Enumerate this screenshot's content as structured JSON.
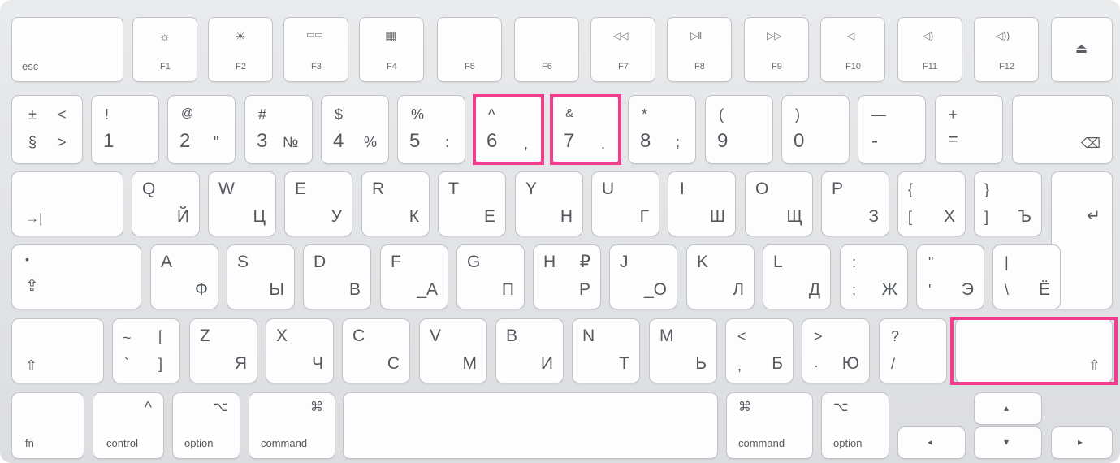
{
  "fn_row": {
    "esc": "esc",
    "f1": {
      "label": "F1",
      "icon": "☼"
    },
    "f2": {
      "label": "F2",
      "icon": "☀"
    },
    "f3": {
      "label": "F3",
      "icon": "▭▭"
    },
    "f4": {
      "label": "F4",
      "icon": "▦"
    },
    "f5": {
      "label": "F5"
    },
    "f6": {
      "label": "F6"
    },
    "f7": {
      "label": "F7",
      "icon": "◁◁"
    },
    "f8": {
      "label": "F8",
      "icon": "▷ǁ"
    },
    "f9": {
      "label": "F9",
      "icon": "▷▷"
    },
    "f10": {
      "label": "F10",
      "icon": "◁"
    },
    "f11": {
      "label": "F11",
      "icon": "◁)"
    },
    "f12": {
      "label": "F12",
      "icon": "◁))"
    },
    "eject_icon": "⏏"
  },
  "num_row": {
    "k0": {
      "tl": "±",
      "tr": "<",
      "bl": "§",
      "br": ">"
    },
    "k1": {
      "tl": "!",
      "bl": "1"
    },
    "k2": {
      "tl": "@",
      "bl": "2",
      "br": "\""
    },
    "k3": {
      "tl": "#",
      "bl": "3",
      "br": "№"
    },
    "k4": {
      "tl": "$",
      "bl": "4",
      "br": "%"
    },
    "k5": {
      "tl": "%",
      "bl": "5",
      "br": ":"
    },
    "k6": {
      "tl": "^",
      "bl": "6",
      "br": ","
    },
    "k7": {
      "tl": "&",
      "bl": "7",
      "br": "."
    },
    "k8": {
      "tl": "*",
      "bl": "8",
      "br": ";"
    },
    "k9": {
      "tl": "(",
      "bl": "9"
    },
    "k10": {
      "tl": ")",
      "bl": "0"
    },
    "k11": {
      "tl": "—",
      "bl": "-"
    },
    "k12": {
      "tl": "+",
      "bl": "="
    },
    "delete_icon": "⌫"
  },
  "q_row": {
    "tab_icon": "→|",
    "keys": [
      {
        "en": "Q",
        "ru": "Й"
      },
      {
        "en": "W",
        "ru": "Ц"
      },
      {
        "en": "E",
        "ru": "У"
      },
      {
        "en": "R",
        "ru": "К"
      },
      {
        "en": "T",
        "ru": "Е"
      },
      {
        "en": "Y",
        "ru": "Н"
      },
      {
        "en": "U",
        "ru": "Г"
      },
      {
        "en": "I",
        "ru": "Ш"
      },
      {
        "en": "O",
        "ru": "Щ"
      },
      {
        "en": "P",
        "ru": "З"
      }
    ],
    "bracket_left": {
      "tl": "{",
      "bl": "[",
      "br": "Х"
    },
    "bracket_right": {
      "tl": "}",
      "bl": "]",
      "br": "Ъ"
    },
    "return_icon": "↵"
  },
  "a_row": {
    "caps_dot": "•",
    "caps_icon": "⇪",
    "keys": [
      {
        "en": "A",
        "ru": "Ф"
      },
      {
        "en": "S",
        "ru": "Ы"
      },
      {
        "en": "D",
        "ru": "В"
      },
      {
        "en": "F",
        "ru": "_А"
      },
      {
        "en": "G",
        "ru": "П"
      },
      {
        "en": "H",
        "extra": "₽",
        "ru": "Р"
      },
      {
        "en": "J",
        "ru": "_О"
      },
      {
        "en": "K",
        "ru": "Л"
      },
      {
        "en": "L",
        "ru": "Д"
      }
    ],
    "semicolon": {
      "tl": ":",
      "bl": ";",
      "br": "Ж"
    },
    "quote": {
      "tl": "\"",
      "bl": "'",
      "br": "Э"
    },
    "backslash": {
      "tl": "|",
      "bl": "\\",
      "br": "Ё"
    }
  },
  "z_row": {
    "shift_icon": "⇧",
    "tilde": {
      "tl": "~",
      "tr": "[",
      "bl": "`",
      "br": "]"
    },
    "keys": [
      {
        "en": "Z",
        "ru": "Я"
      },
      {
        "en": "X",
        "ru": "Ч"
      },
      {
        "en": "C",
        "ru": "С"
      },
      {
        "en": "V",
        "ru": "М"
      },
      {
        "en": "B",
        "ru": "И"
      },
      {
        "en": "N",
        "ru": "Т"
      },
      {
        "en": "M",
        "ru": "Ь"
      }
    ],
    "comma": {
      "tl": "<",
      "bl": ",",
      "br": "Б"
    },
    "period": {
      "tl": ">",
      "bl": "·",
      "br": "Ю"
    },
    "slash": {
      "tl": "?",
      "bl": "/"
    }
  },
  "bottom_row": {
    "fn": "fn",
    "control": {
      "label": "control",
      "icon": "^"
    },
    "option_left": {
      "label": "option",
      "icon": "⌥"
    },
    "command_left": {
      "label": "command",
      "icon": "⌘"
    },
    "command_right": {
      "label": "command",
      "icon": "⌘"
    },
    "option_right": {
      "label": "option",
      "icon": "⌥"
    },
    "arrow_left": "◂",
    "arrow_up": "▴",
    "arrow_down": "▾",
    "arrow_right": "▸"
  },
  "highlight_color": "#f23c8e"
}
